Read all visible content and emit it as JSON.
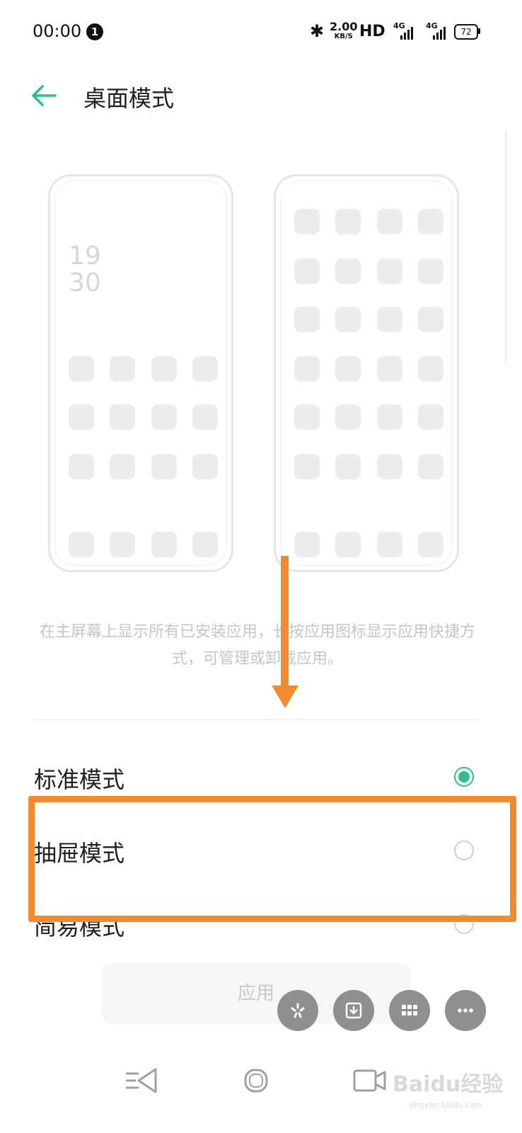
{
  "status_bar": {
    "time": "00:00",
    "notification_count": "1",
    "net_speed": "2.00",
    "net_speed_unit": "KB/S",
    "hd": "HD",
    "signal_1": "4G",
    "signal_2": "4G",
    "battery": "72"
  },
  "header": {
    "title": "桌面模式"
  },
  "preview": {
    "clock_hours": "19",
    "clock_minutes": "30"
  },
  "description": "在主屏幕上显示所有已安装应用，长按应用图标显示应用快捷方式，可管理或卸载应用。",
  "options": [
    {
      "label": "标准模式",
      "selected": true
    },
    {
      "label": "抽屉模式",
      "selected": false
    },
    {
      "label": "简易模式",
      "selected": false
    }
  ],
  "apply_button": "应用",
  "watermark": {
    "text": "Baidu经验",
    "sub": "jingyan.baidu.com"
  },
  "colors": {
    "accent": "#2fbf86",
    "annotation": "#f28a32"
  }
}
